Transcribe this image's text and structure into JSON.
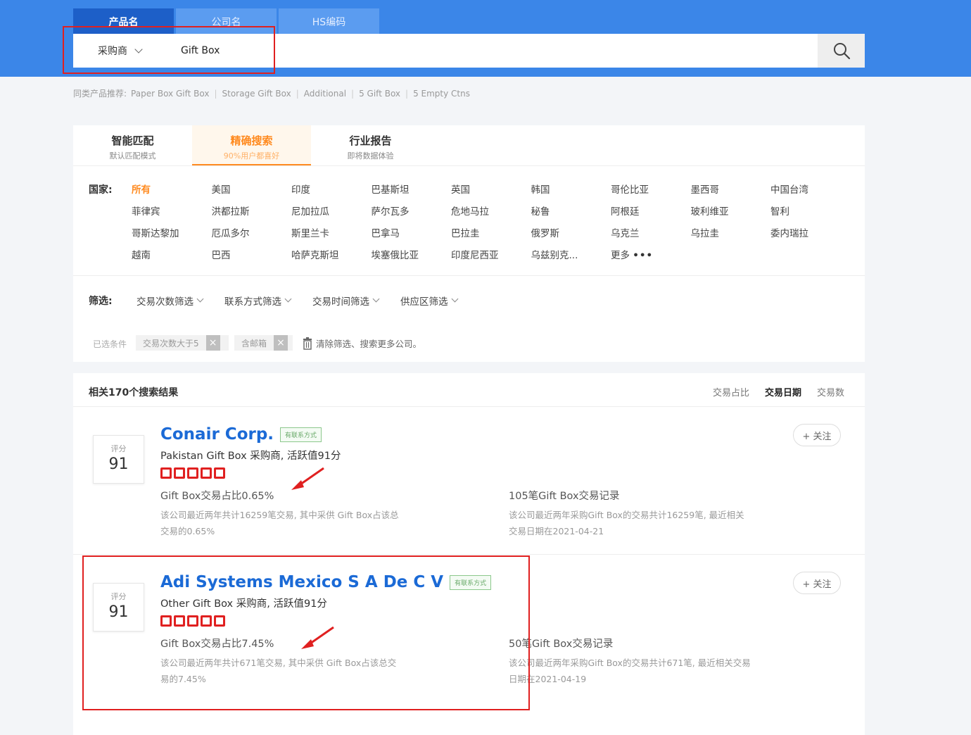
{
  "search": {
    "tabs": [
      "产品名",
      "公司名",
      "HS编码"
    ],
    "role": "采购商",
    "query": "Gift Box"
  },
  "recommend": {
    "label": "同类产品推荐:",
    "items": [
      "Paper Box Gift Box",
      "Storage Gift Box",
      "Additional",
      "5 Gift Box",
      "5 Empty Ctns"
    ]
  },
  "mode_tabs": [
    {
      "title": "智能匹配",
      "sub": "默认匹配模式"
    },
    {
      "title": "精确搜索",
      "sub": "90%用户都喜好"
    },
    {
      "title": "行业报告",
      "sub": "即将数据体验"
    }
  ],
  "countries": {
    "label": "国家:",
    "items": [
      "所有",
      "美国",
      "印度",
      "巴基斯坦",
      "英国",
      "韩国",
      "哥伦比亚",
      "墨西哥",
      "中国台湾",
      "菲律宾",
      "洪都拉斯",
      "尼加拉瓜",
      "萨尔瓦多",
      "危地马拉",
      "秘鲁",
      "阿根廷",
      "玻利维亚",
      "智利",
      "哥斯达黎加",
      "厄瓜多尔",
      "斯里兰卡",
      "巴拿马",
      "巴拉圭",
      "俄罗斯",
      "乌克兰",
      "乌拉圭",
      "委内瑞拉",
      "越南",
      "巴西",
      "哈萨克斯坦",
      "埃塞俄比亚",
      "印度尼西亚",
      "乌兹别克...",
      "更多"
    ],
    "more_dots": "•••"
  },
  "filters": {
    "label": "筛选:",
    "items": [
      "交易次数筛选",
      "联系方式筛选",
      "交易时间筛选",
      "供应区筛选"
    ]
  },
  "conditions": {
    "label": "已选条件",
    "chips": [
      "交易次数大于5",
      "含邮箱"
    ],
    "clear": "清除筛选、搜索更多公司。"
  },
  "results": {
    "count_label": "相关170个搜索结果",
    "sort": [
      "交易占比",
      "交易日期",
      "交易数"
    ],
    "cards": [
      {
        "score_label": "评分",
        "score": "91",
        "name": "Conair Corp.",
        "badge": "有联系方式",
        "desc": "Pakistan Gift Box 采购商, 活跃值91分",
        "share": "Gift Box交易占比0.65%",
        "share_note": "该公司最近两年共计16259笔交易, 其中采供 Gift Box占该总交易的0.65%",
        "records": "105笔Gift Box交易记录",
        "records_note": "该公司最近两年采购Gift Box的交易共计16259笔, 最近相关交易日期在2021-04-21",
        "follow": "+ 关注"
      },
      {
        "score_label": "评分",
        "score": "91",
        "name": "Adi Systems Mexico S A De C V",
        "badge": "有联系方式",
        "desc": "Other Gift Box 采购商, 活跃值91分",
        "share": "Gift Box交易占比7.45%",
        "share_note": "该公司最近两年共计671笔交易, 其中采供 Gift Box占该总交易的7.45%",
        "records": "50笔Gift Box交易记录",
        "records_note": "该公司最近两年采购Gift Box的交易共计671笔, 最近相关交易日期在2021-04-19",
        "follow": "+ 关注"
      }
    ]
  },
  "colors": {
    "topbar": "#3b86e8",
    "accent_orange": "#ff8a1f",
    "company_link": "#1b6ad6",
    "annotation_red": "#e02020"
  }
}
